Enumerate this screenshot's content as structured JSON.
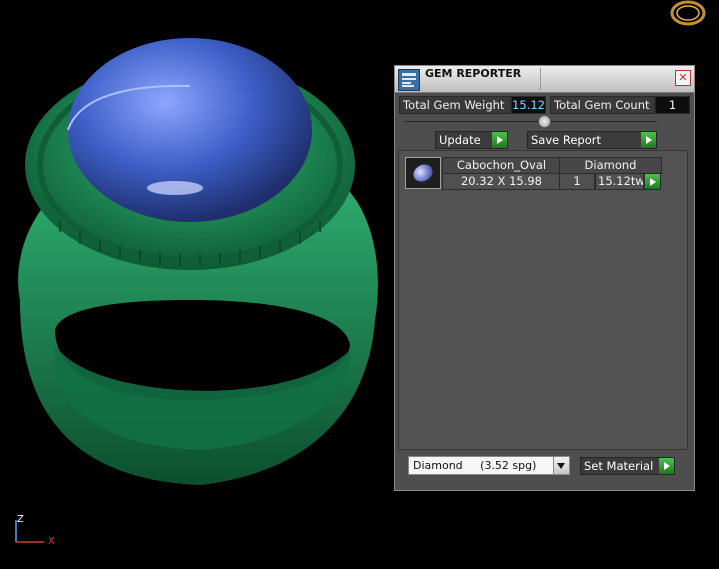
{
  "window": {
    "title": "GEM REPORTER",
    "close_glyph": "✕"
  },
  "summary": {
    "total_weight_label": "Total Gem Weight",
    "total_weight_value": "15.12",
    "total_count_label": "Total Gem Count",
    "total_count_value": "1"
  },
  "toolbar": {
    "update_label": "Update",
    "save_report_label": "Save Report"
  },
  "gem_table": {
    "rows": [
      {
        "cut": "Cabochon_Oval",
        "material": "Diamond",
        "size": "20.32 X 15.98",
        "count": "1",
        "weight": "15.12tw"
      }
    ]
  },
  "material_select": {
    "value": "Diamond     (3.52 spg)"
  },
  "set_material_label": "Set Material",
  "axes": {
    "z": "Z",
    "x": "X"
  },
  "colors": {
    "ring_green": "#1f8a57",
    "gem_blue": "#3b5fc4",
    "panel_bg": "#4e4e4e",
    "accent_green": "#2ea12e"
  },
  "icons": {
    "app": "gem-reporter-app-icon",
    "logo": "ring-logo-icon",
    "close": "close-icon",
    "arrow": "play-arrow-icon"
  }
}
